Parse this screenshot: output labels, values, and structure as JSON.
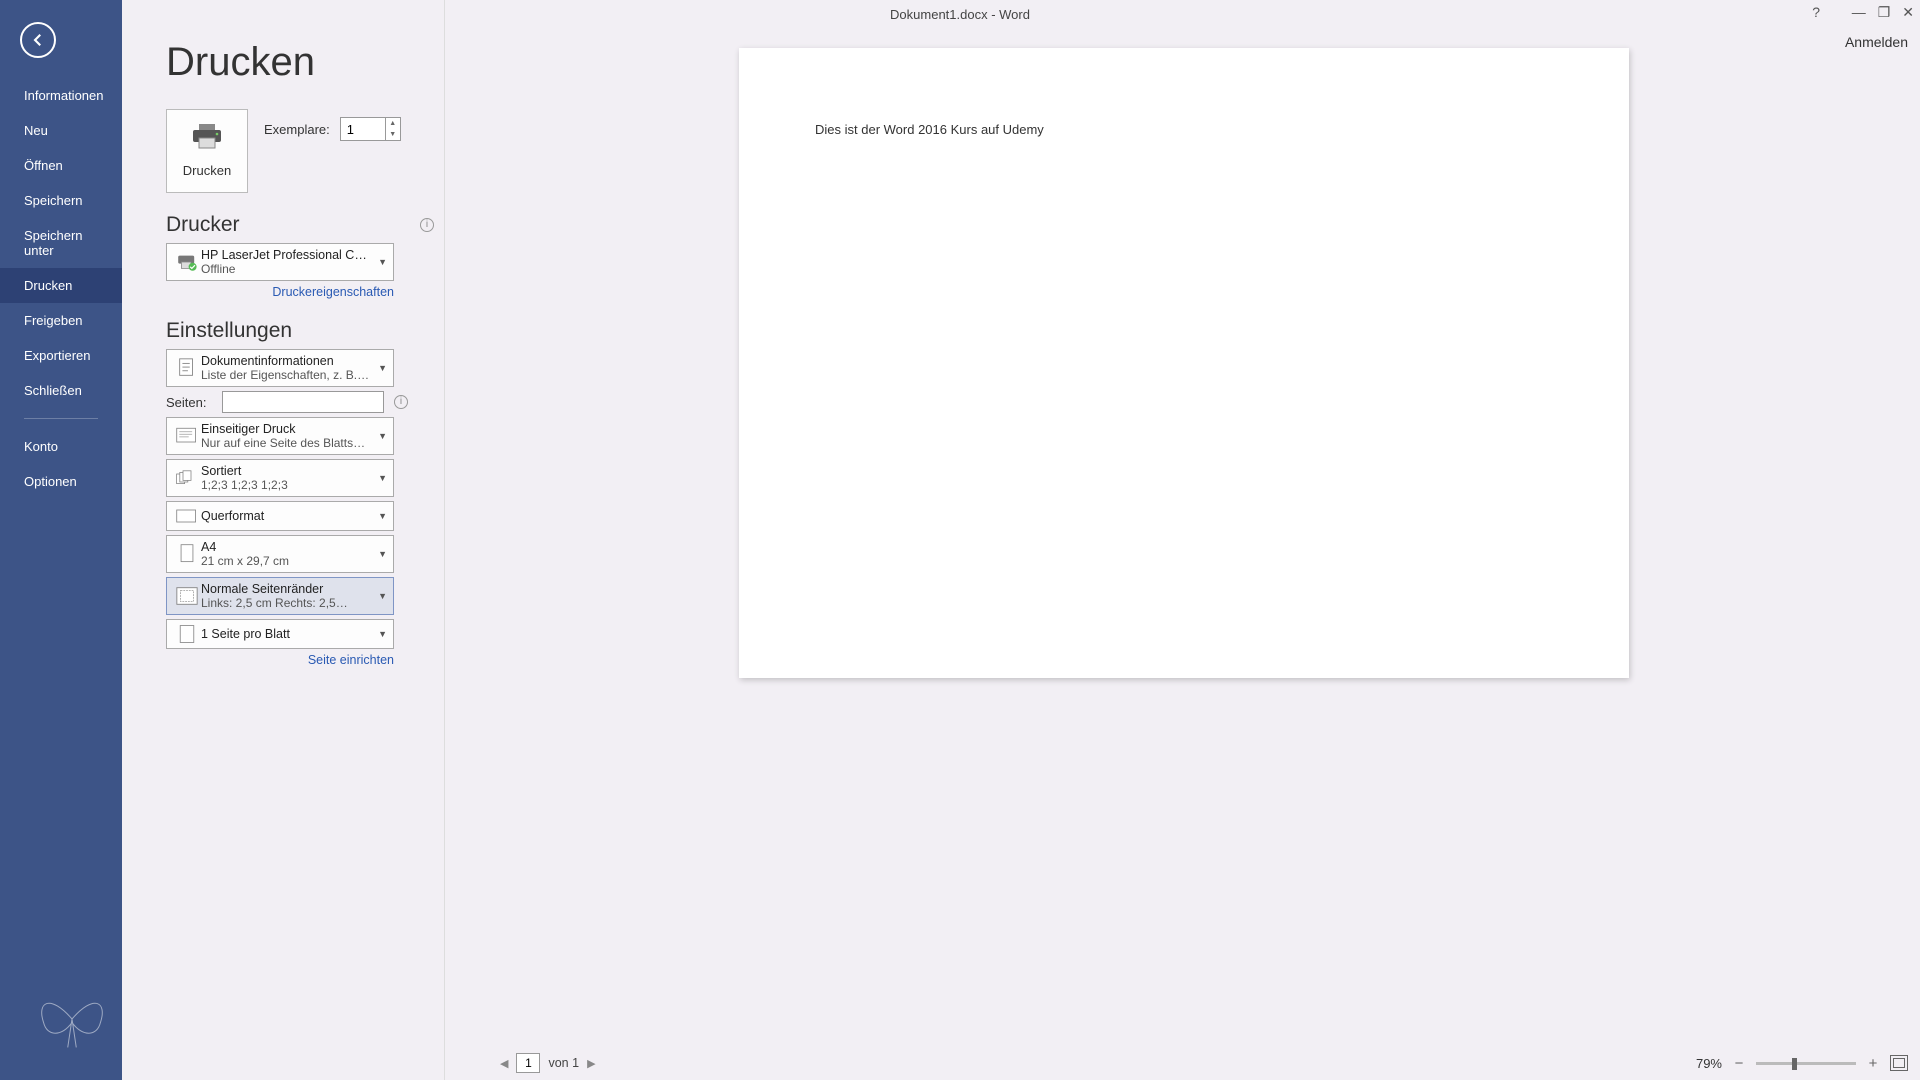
{
  "window": {
    "title": "Dokument1.docx - Word",
    "sign_in": "Anmelden"
  },
  "sidebar": {
    "items": [
      {
        "label": "Informationen"
      },
      {
        "label": "Neu"
      },
      {
        "label": "Öffnen"
      },
      {
        "label": "Speichern"
      },
      {
        "label": "Speichern unter"
      },
      {
        "label": "Drucken"
      },
      {
        "label": "Freigeben"
      },
      {
        "label": "Exportieren"
      },
      {
        "label": "Schließen"
      }
    ],
    "footer_items": [
      {
        "label": "Konto"
      },
      {
        "label": "Optionen"
      }
    ],
    "active_index": 5
  },
  "page": {
    "heading": "Drucken",
    "print_button": "Drucken",
    "copies_label": "Exemplare:",
    "copies_value": "1"
  },
  "printer_section": {
    "heading": "Drucker",
    "selected": {
      "name": "HP LaserJet Professional CP…",
      "status": "Offline"
    },
    "properties_link": "Druckereigenschaften"
  },
  "settings_section": {
    "heading": "Einstellungen",
    "what_to_print": {
      "line1": "Dokumentinformationen",
      "line2": "Liste der Eigenschaften, z. B.…"
    },
    "pages_label": "Seiten:",
    "pages_value": "",
    "sides": {
      "line1": "Einseitiger Druck",
      "line2": "Nur auf eine Seite des Blatts…"
    },
    "collation": {
      "line1": "Sortiert",
      "line2": "1;2;3    1;2;3    1;2;3"
    },
    "orientation": {
      "line1": "Querformat"
    },
    "paper": {
      "line1": "A4",
      "line2": "21 cm x 29,7 cm"
    },
    "margins": {
      "line1": "Normale Seitenränder",
      "line2": "Links: 2,5 cm   Rechts: 2,5…"
    },
    "pages_per_sheet": {
      "line1": "1 Seite pro Blatt"
    },
    "page_setup_link": "Seite einrichten"
  },
  "preview": {
    "body_text": "Dies ist der Word 2016 Kurs auf Udemy"
  },
  "bottom": {
    "page_current": "1",
    "page_of": "von 1",
    "zoom_pct": "79%"
  },
  "colors": {
    "sidebar_bg": "#3d5487",
    "sidebar_active": "#2d4174",
    "link": "#2a5ab3"
  }
}
